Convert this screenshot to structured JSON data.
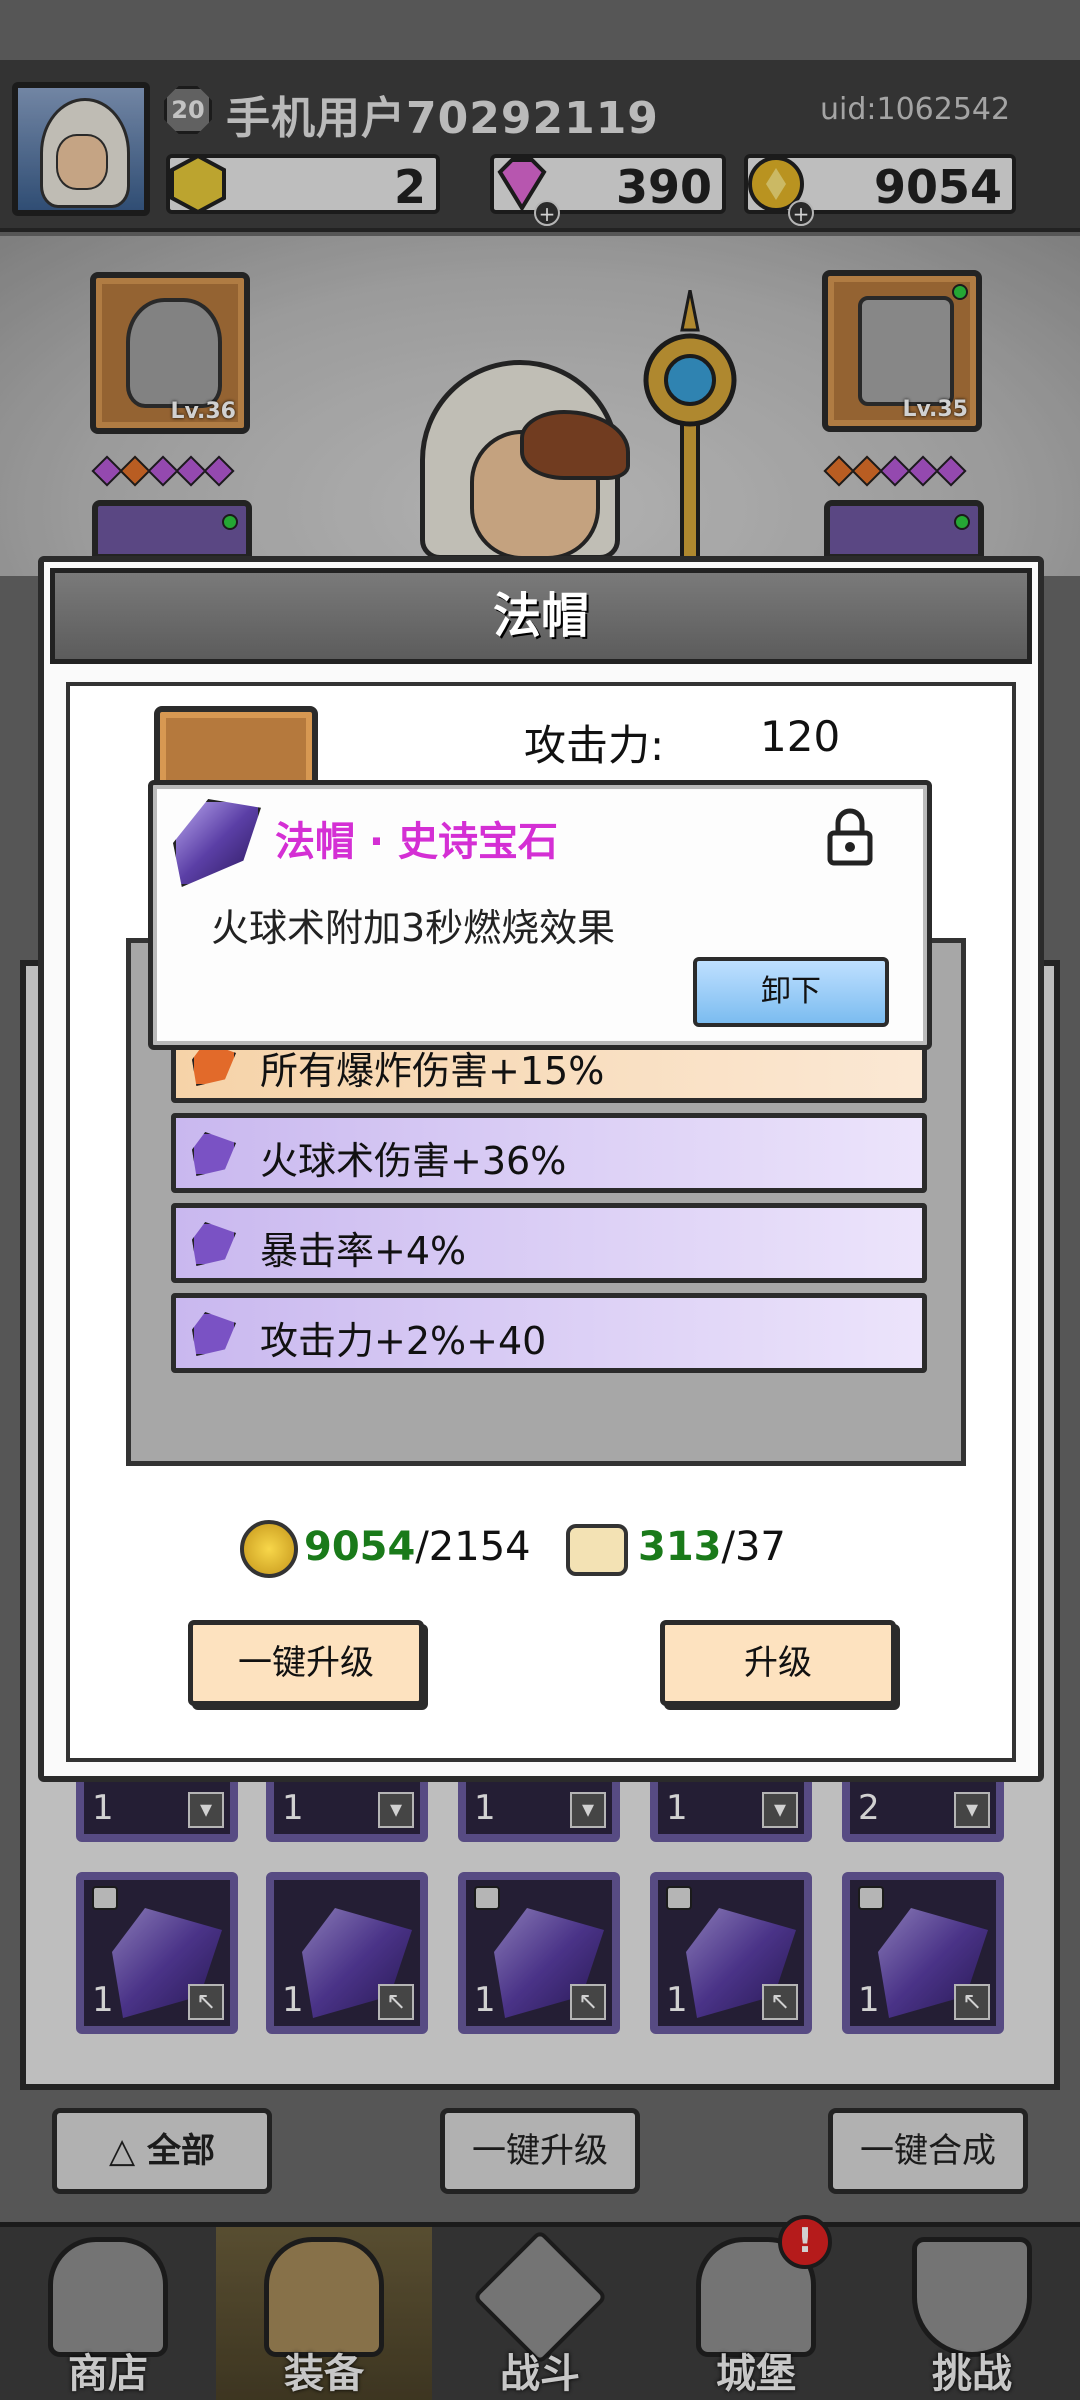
{
  "header": {
    "level": "20",
    "username": "手机用户70292119",
    "uid": "uid:1062542",
    "resources": {
      "stones": "2",
      "diamonds": "390",
      "gold": "9054"
    },
    "plus": "+"
  },
  "equipment_slots": {
    "left_top_level": "Lv.36",
    "right_top_level": "Lv.35"
  },
  "modal": {
    "title": "法帽",
    "stat_label": "攻击力:",
    "stat_value": "120",
    "gem_popup": {
      "title": "法帽 · 史诗宝石",
      "description": "火球术附加3秒燃烧效果",
      "unequip_label": "卸下"
    },
    "bonuses": [
      {
        "text": "所有爆炸伤害+15%",
        "tier": "orange"
      },
      {
        "text": "火球术伤害+36%",
        "tier": "purple"
      },
      {
        "text": "暴击率+4%",
        "tier": "purple"
      },
      {
        "text": "攻击力+2%+40",
        "tier": "purple"
      }
    ],
    "costs": {
      "gold_have": "9054",
      "gold_need": "/2154",
      "scroll_have": "313",
      "scroll_need": "/37"
    },
    "upgrade_all_label": "一键升级",
    "upgrade_label": "升级"
  },
  "inventory": {
    "top_row_counts": [
      "1",
      "1",
      "1",
      "1",
      "2"
    ],
    "gem_row_counts": [
      "1",
      "1",
      "1",
      "1",
      "1"
    ]
  },
  "actions": {
    "filter_label": "全部",
    "upgrade_all_label": "一键升级",
    "merge_all_label": "一键合成"
  },
  "nav": [
    {
      "label": "商店"
    },
    {
      "label": "装备"
    },
    {
      "label": "战斗"
    },
    {
      "label": "城堡"
    },
    {
      "label": "挑战"
    }
  ],
  "alert_badge": "!",
  "colors": {
    "epic_gem_title": "#d42fd4",
    "cost_ok": "#1a7a1a",
    "legend_bonus": "#f6d3a8",
    "epic_bonus": "#c9b8ef"
  }
}
